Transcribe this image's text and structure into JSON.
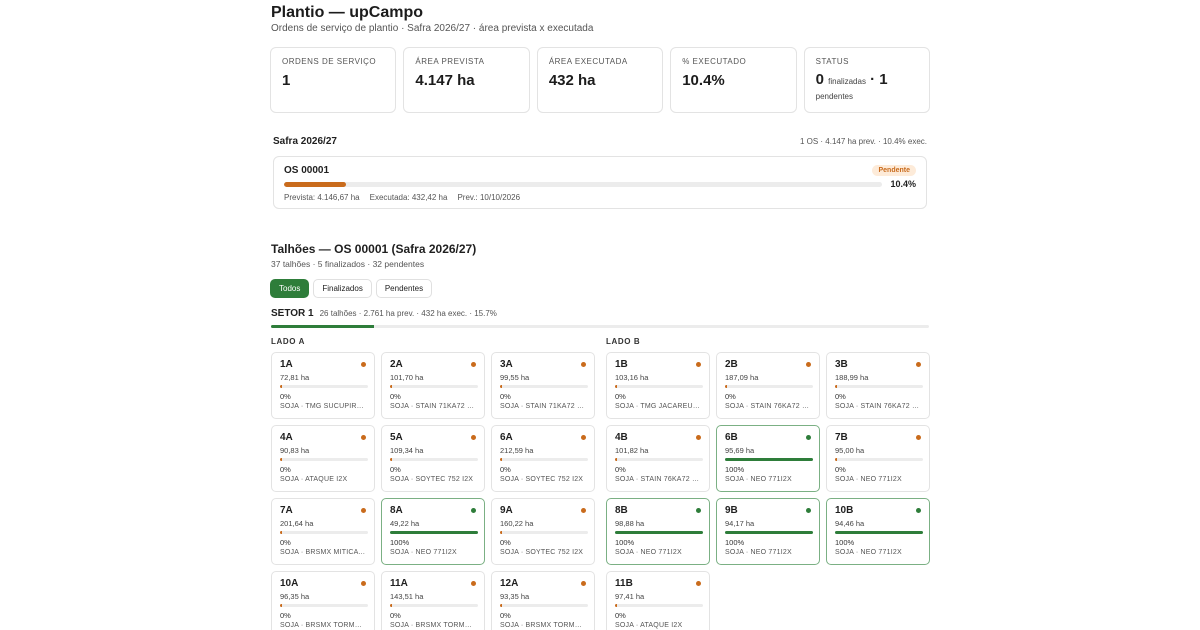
{
  "header": {
    "title": "Plantio — upCampo",
    "subtitle": "Ordens de serviço de plantio · Safra 2026/27 · área prevista x executada"
  },
  "kpis": [
    {
      "label": "ORDENS DE SERVIÇO",
      "value": "1"
    },
    {
      "label": "ÁREA PREVISTA",
      "value": "4.147 ha"
    },
    {
      "label": "ÁREA EXECUTADA",
      "value": "432 ha"
    },
    {
      "label": "% EXECUTADO",
      "value": "10.4%"
    }
  ],
  "status_kpi": {
    "label": "STATUS",
    "finalizadas_count": "0",
    "finalizadas_label": "finalizadas",
    "separator": "·",
    "pendentes_count": "1",
    "pendentes_label": "pendentes"
  },
  "safra": {
    "title": "Safra 2026/27",
    "summary": "1 OS · 4.147 ha prev. · 10.4% exec."
  },
  "os": {
    "title": "OS 00001",
    "badge": "Pendente",
    "progress": 0.104,
    "pct": "10.4%",
    "prevista": "Prevista: 4.146,67 ha",
    "executada": "Executada: 432,42 ha",
    "prev_date": "Prev.: 10/10/2026"
  },
  "talhoes": {
    "title": "Talhões — OS 00001 (Safra 2026/27)",
    "subtitle": "37 talhões · 5 finalizados · 32 pendentes",
    "filters": [
      "Todos",
      "Finalizados",
      "Pendentes"
    ]
  },
  "setor": {
    "name": "SETOR 1",
    "summary": "26 talhões · 2.761 ha prev. · 432 ha exec. · 15.7%",
    "progress": 0.157
  },
  "colors": {
    "pending": "#c96b1c",
    "done": "#2e7d3a"
  },
  "lado_a": {
    "label": "LADO A",
    "cards": [
      {
        "name": "1A",
        "area": "72,81 ha",
        "pct": "0%",
        "variety": "SOJA · TMG SUCUPIRA ...",
        "done": false,
        "progress": 0
      },
      {
        "name": "2A",
        "area": "101,70 ha",
        "pct": "0%",
        "variety": "SOJA · STAIN 71KA72 CE",
        "done": false,
        "progress": 0
      },
      {
        "name": "3A",
        "area": "99,55 ha",
        "pct": "0%",
        "variety": "SOJA · STAIN 71KA72 CE",
        "done": false,
        "progress": 0
      },
      {
        "name": "4A",
        "area": "90,83 ha",
        "pct": "0%",
        "variety": "SOJA · ATAQUE I2X",
        "done": false,
        "progress": 0
      },
      {
        "name": "5A",
        "area": "109,34 ha",
        "pct": "0%",
        "variety": "SOJA · SOYTEC 752 I2X",
        "done": false,
        "progress": 0
      },
      {
        "name": "6A",
        "area": "212,59 ha",
        "pct": "0%",
        "variety": "SOJA · SOYTEC 752 I2X",
        "done": false,
        "progress": 0
      },
      {
        "name": "7A",
        "area": "201,64 ha",
        "pct": "0%",
        "variety": "SOJA · BRSMX MITICA C...",
        "done": false,
        "progress": 0
      },
      {
        "name": "8A",
        "area": "49,22 ha",
        "pct": "100%",
        "variety": "SOJA · NEO 771I2X",
        "done": true,
        "progress": 1
      },
      {
        "name": "9A",
        "area": "160,22 ha",
        "pct": "0%",
        "variety": "SOJA · SOYTEC 752 I2X",
        "done": false,
        "progress": 0
      },
      {
        "name": "10A",
        "area": "96,35 ha",
        "pct": "0%",
        "variety": "SOJA · BRSMX TORMEN...",
        "done": false,
        "progress": 0
      },
      {
        "name": "11A",
        "area": "143,51 ha",
        "pct": "0%",
        "variety": "SOJA · BRSMX TORMEN...",
        "done": false,
        "progress": 0
      },
      {
        "name": "12A",
        "area": "93,35 ha",
        "pct": "0%",
        "variety": "SOJA · BRSMX TORMEN...",
        "done": false,
        "progress": 0
      }
    ]
  },
  "lado_b": {
    "label": "LADO B",
    "cards": [
      {
        "name": "1B",
        "area": "103,16 ha",
        "pct": "0%",
        "variety": "SOJA · TMG JACAREUBA...",
        "done": false,
        "progress": 0
      },
      {
        "name": "2B",
        "area": "187,09 ha",
        "pct": "0%",
        "variety": "SOJA · STAIN 76KA72 CE",
        "done": false,
        "progress": 0
      },
      {
        "name": "3B",
        "area": "188,99 ha",
        "pct": "0%",
        "variety": "SOJA · STAIN 76KA72 CE",
        "done": false,
        "progress": 0
      },
      {
        "name": "4B",
        "area": "101,82 ha",
        "pct": "0%",
        "variety": "SOJA · STAIN 76KA72 CE",
        "done": false,
        "progress": 0
      },
      {
        "name": "6B",
        "area": "95,69 ha",
        "pct": "100%",
        "variety": "SOJA · NEO 771I2X",
        "done": true,
        "progress": 1
      },
      {
        "name": "7B",
        "area": "95,00 ha",
        "pct": "0%",
        "variety": "SOJA · NEO 771I2X",
        "done": false,
        "progress": 0
      },
      {
        "name": "8B",
        "area": "98,88 ha",
        "pct": "100%",
        "variety": "SOJA · NEO 771I2X",
        "done": true,
        "progress": 1
      },
      {
        "name": "9B",
        "area": "94,17 ha",
        "pct": "100%",
        "variety": "SOJA · NEO 771I2X",
        "done": true,
        "progress": 1
      },
      {
        "name": "10B",
        "area": "94,46 ha",
        "pct": "100%",
        "variety": "SOJA · NEO 771I2X",
        "done": true,
        "progress": 1
      },
      {
        "name": "11B",
        "area": "97,41 ha",
        "pct": "0%",
        "variety": "SOJA · ATAQUE I2X",
        "done": false,
        "progress": 0
      }
    ]
  }
}
